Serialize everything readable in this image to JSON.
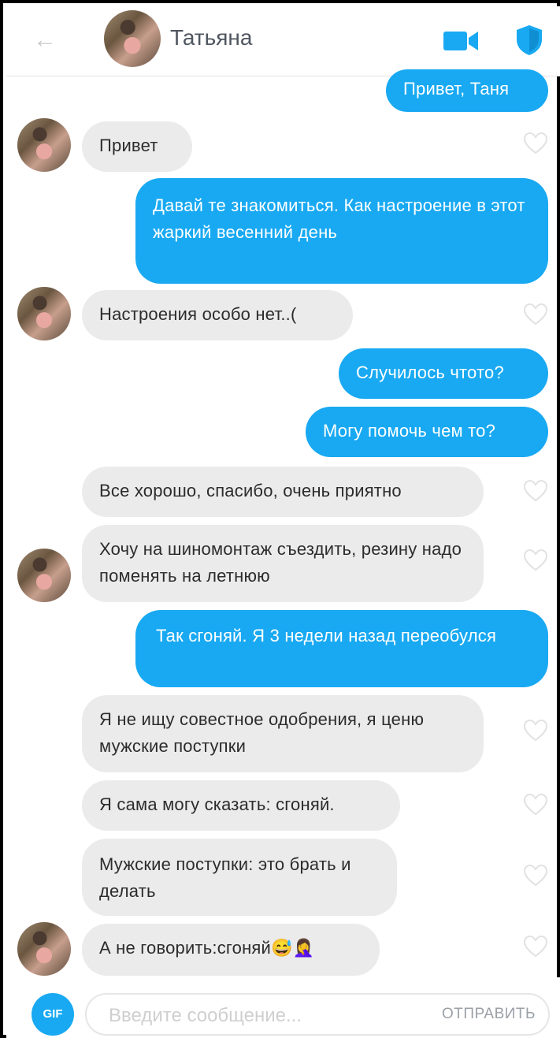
{
  "header": {
    "contact_name": "Татьяна",
    "back_icon": "arrow-left-icon",
    "video_icon": "video-camera-icon",
    "shield_icon": "shield-icon",
    "accent_color": "#18a9f2"
  },
  "messages": [
    {
      "side": "out",
      "text": "Привет, Таня"
    },
    {
      "side": "in",
      "text": "Привет"
    },
    {
      "side": "out",
      "text": "Давай те знакомиться. Как настроение в этот жаркий весенний день"
    },
    {
      "side": "in",
      "text": "Настроения особо нет..("
    },
    {
      "side": "out",
      "text": "Случилось чтото?"
    },
    {
      "side": "out",
      "text": "Могу помочь чем то?"
    },
    {
      "side": "in",
      "text": "Все хорошо, спасибо, очень приятно"
    },
    {
      "side": "in",
      "text": "Хочу на шиномонтаж съездить, резину надо поменять на летнюю"
    },
    {
      "side": "out",
      "text": "Так сгоняй. Я 3 недели назад переобулся"
    },
    {
      "side": "in",
      "text": "Я не ищу совестное одобрения, я ценю мужские поступки"
    },
    {
      "side": "in",
      "text": "Я сама могу сказать: сгоняй."
    },
    {
      "side": "in",
      "text": "Мужские поступки: это брать и делать"
    },
    {
      "side": "in",
      "text": "А не говорить:сгоняй😅🤦‍♀️"
    }
  ],
  "footer": {
    "gif_label": "GIF",
    "input_placeholder": "Введите сообщение...",
    "input_value": "",
    "send_label": "ОТПРАВИТЬ"
  }
}
